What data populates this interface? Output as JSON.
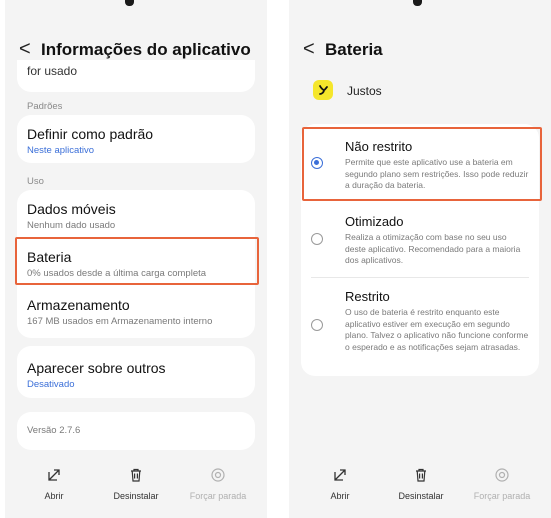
{
  "left": {
    "header": {
      "back_glyph": "<",
      "title": "Informações do aplicativo"
    },
    "partial_text": "for usado",
    "sections": {
      "defaults_label": "Padrões",
      "use_label": "Uso"
    },
    "rows": {
      "default": {
        "title": "Definir como padrão",
        "sub": "Neste aplicativo"
      },
      "mobile_data": {
        "title": "Dados móveis",
        "sub": "Nenhum dado usado"
      },
      "battery": {
        "title": "Bateria",
        "sub": "0% usados desde a última carga completa"
      },
      "storage": {
        "title": "Armazenamento",
        "sub": "167 MB usados em Armazenamento interno"
      },
      "overlay": {
        "title": "Aparecer sobre outros",
        "sub": "Desativado"
      },
      "version": "Versão 2.7.6"
    },
    "bottom": {
      "open": "Abrir",
      "uninstall": "Desinstalar",
      "force_stop": "Forçar parada"
    }
  },
  "right": {
    "header": {
      "back_glyph": "<",
      "title": "Bateria"
    },
    "app_name": "Justos",
    "options": {
      "unrestricted": {
        "title": "Não restrito",
        "desc": "Permite que este aplicativo use a bateria em segundo plano sem restrições. Isso pode reduzir a duração da bateria.",
        "selected": true
      },
      "optimized": {
        "title": "Otimizado",
        "desc": "Realiza a otimização com base no seu uso deste aplicativo. Recomendado para a maioria dos aplicativos.",
        "selected": false
      },
      "restricted": {
        "title": "Restrito",
        "desc": "O uso de bateria é restrito enquanto este aplicativo estiver em execução em segundo plano. Talvez o aplicativo não funcione conforme o esperado e as notificações sejam atrasadas.",
        "selected": false
      }
    },
    "bottom": {
      "open": "Abrir",
      "uninstall": "Desinstalar",
      "force_stop": "Forçar parada"
    }
  },
  "colors": {
    "accent": "#3b6fd8",
    "highlight": "#e8643b",
    "app_icon": "#f5e62b"
  },
  "icons": [
    "back-icon",
    "open-icon",
    "trash-icon",
    "stop-icon",
    "app-icon"
  ]
}
